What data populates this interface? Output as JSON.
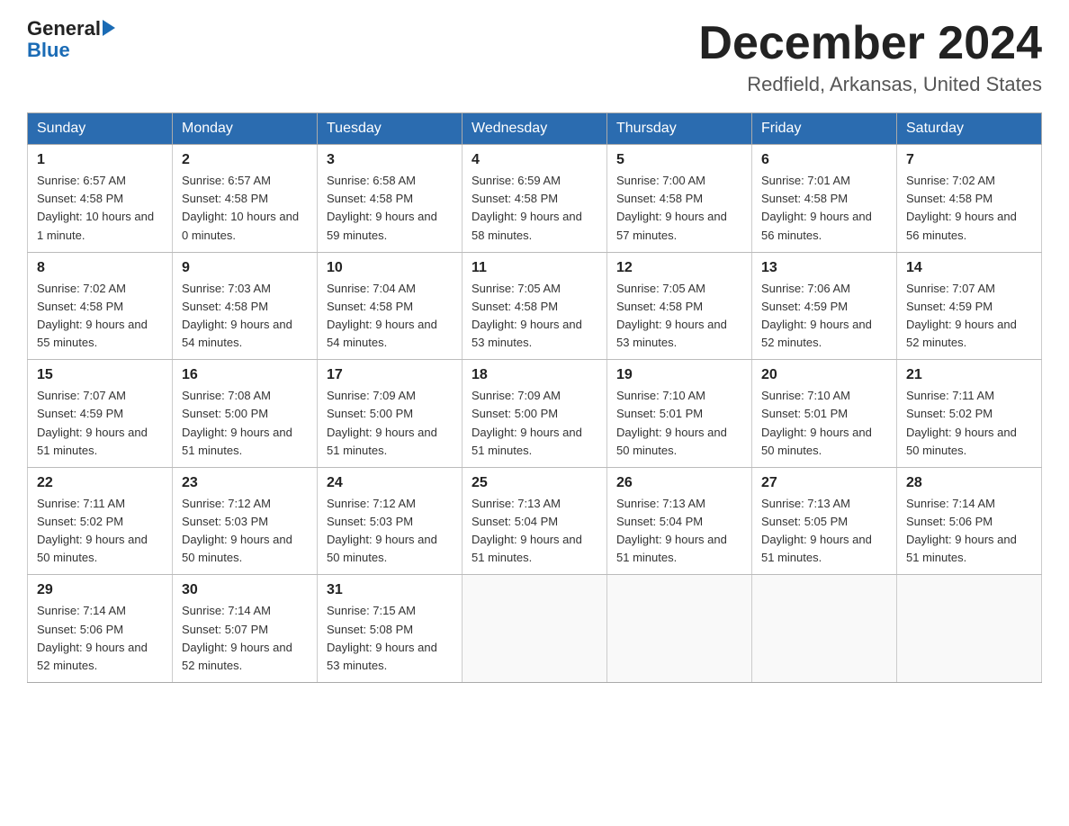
{
  "header": {
    "logo_line1": "General",
    "logo_line2": "Blue",
    "month_title": "December 2024",
    "location": "Redfield, Arkansas, United States"
  },
  "weekdays": [
    "Sunday",
    "Monday",
    "Tuesday",
    "Wednesday",
    "Thursday",
    "Friday",
    "Saturday"
  ],
  "weeks": [
    [
      {
        "day": "1",
        "sunrise": "6:57 AM",
        "sunset": "4:58 PM",
        "daylight": "10 hours and 1 minute."
      },
      {
        "day": "2",
        "sunrise": "6:57 AM",
        "sunset": "4:58 PM",
        "daylight": "10 hours and 0 minutes."
      },
      {
        "day": "3",
        "sunrise": "6:58 AM",
        "sunset": "4:58 PM",
        "daylight": "9 hours and 59 minutes."
      },
      {
        "day": "4",
        "sunrise": "6:59 AM",
        "sunset": "4:58 PM",
        "daylight": "9 hours and 58 minutes."
      },
      {
        "day": "5",
        "sunrise": "7:00 AM",
        "sunset": "4:58 PM",
        "daylight": "9 hours and 57 minutes."
      },
      {
        "day": "6",
        "sunrise": "7:01 AM",
        "sunset": "4:58 PM",
        "daylight": "9 hours and 56 minutes."
      },
      {
        "day": "7",
        "sunrise": "7:02 AM",
        "sunset": "4:58 PM",
        "daylight": "9 hours and 56 minutes."
      }
    ],
    [
      {
        "day": "8",
        "sunrise": "7:02 AM",
        "sunset": "4:58 PM",
        "daylight": "9 hours and 55 minutes."
      },
      {
        "day": "9",
        "sunrise": "7:03 AM",
        "sunset": "4:58 PM",
        "daylight": "9 hours and 54 minutes."
      },
      {
        "day": "10",
        "sunrise": "7:04 AM",
        "sunset": "4:58 PM",
        "daylight": "9 hours and 54 minutes."
      },
      {
        "day": "11",
        "sunrise": "7:05 AM",
        "sunset": "4:58 PM",
        "daylight": "9 hours and 53 minutes."
      },
      {
        "day": "12",
        "sunrise": "7:05 AM",
        "sunset": "4:58 PM",
        "daylight": "9 hours and 53 minutes."
      },
      {
        "day": "13",
        "sunrise": "7:06 AM",
        "sunset": "4:59 PM",
        "daylight": "9 hours and 52 minutes."
      },
      {
        "day": "14",
        "sunrise": "7:07 AM",
        "sunset": "4:59 PM",
        "daylight": "9 hours and 52 minutes."
      }
    ],
    [
      {
        "day": "15",
        "sunrise": "7:07 AM",
        "sunset": "4:59 PM",
        "daylight": "9 hours and 51 minutes."
      },
      {
        "day": "16",
        "sunrise": "7:08 AM",
        "sunset": "5:00 PM",
        "daylight": "9 hours and 51 minutes."
      },
      {
        "day": "17",
        "sunrise": "7:09 AM",
        "sunset": "5:00 PM",
        "daylight": "9 hours and 51 minutes."
      },
      {
        "day": "18",
        "sunrise": "7:09 AM",
        "sunset": "5:00 PM",
        "daylight": "9 hours and 51 minutes."
      },
      {
        "day": "19",
        "sunrise": "7:10 AM",
        "sunset": "5:01 PM",
        "daylight": "9 hours and 50 minutes."
      },
      {
        "day": "20",
        "sunrise": "7:10 AM",
        "sunset": "5:01 PM",
        "daylight": "9 hours and 50 minutes."
      },
      {
        "day": "21",
        "sunrise": "7:11 AM",
        "sunset": "5:02 PM",
        "daylight": "9 hours and 50 minutes."
      }
    ],
    [
      {
        "day": "22",
        "sunrise": "7:11 AM",
        "sunset": "5:02 PM",
        "daylight": "9 hours and 50 minutes."
      },
      {
        "day": "23",
        "sunrise": "7:12 AM",
        "sunset": "5:03 PM",
        "daylight": "9 hours and 50 minutes."
      },
      {
        "day": "24",
        "sunrise": "7:12 AM",
        "sunset": "5:03 PM",
        "daylight": "9 hours and 50 minutes."
      },
      {
        "day": "25",
        "sunrise": "7:13 AM",
        "sunset": "5:04 PM",
        "daylight": "9 hours and 51 minutes."
      },
      {
        "day": "26",
        "sunrise": "7:13 AM",
        "sunset": "5:04 PM",
        "daylight": "9 hours and 51 minutes."
      },
      {
        "day": "27",
        "sunrise": "7:13 AM",
        "sunset": "5:05 PM",
        "daylight": "9 hours and 51 minutes."
      },
      {
        "day": "28",
        "sunrise": "7:14 AM",
        "sunset": "5:06 PM",
        "daylight": "9 hours and 51 minutes."
      }
    ],
    [
      {
        "day": "29",
        "sunrise": "7:14 AM",
        "sunset": "5:06 PM",
        "daylight": "9 hours and 52 minutes."
      },
      {
        "day": "30",
        "sunrise": "7:14 AM",
        "sunset": "5:07 PM",
        "daylight": "9 hours and 52 minutes."
      },
      {
        "day": "31",
        "sunrise": "7:15 AM",
        "sunset": "5:08 PM",
        "daylight": "9 hours and 53 minutes."
      },
      null,
      null,
      null,
      null
    ]
  ]
}
